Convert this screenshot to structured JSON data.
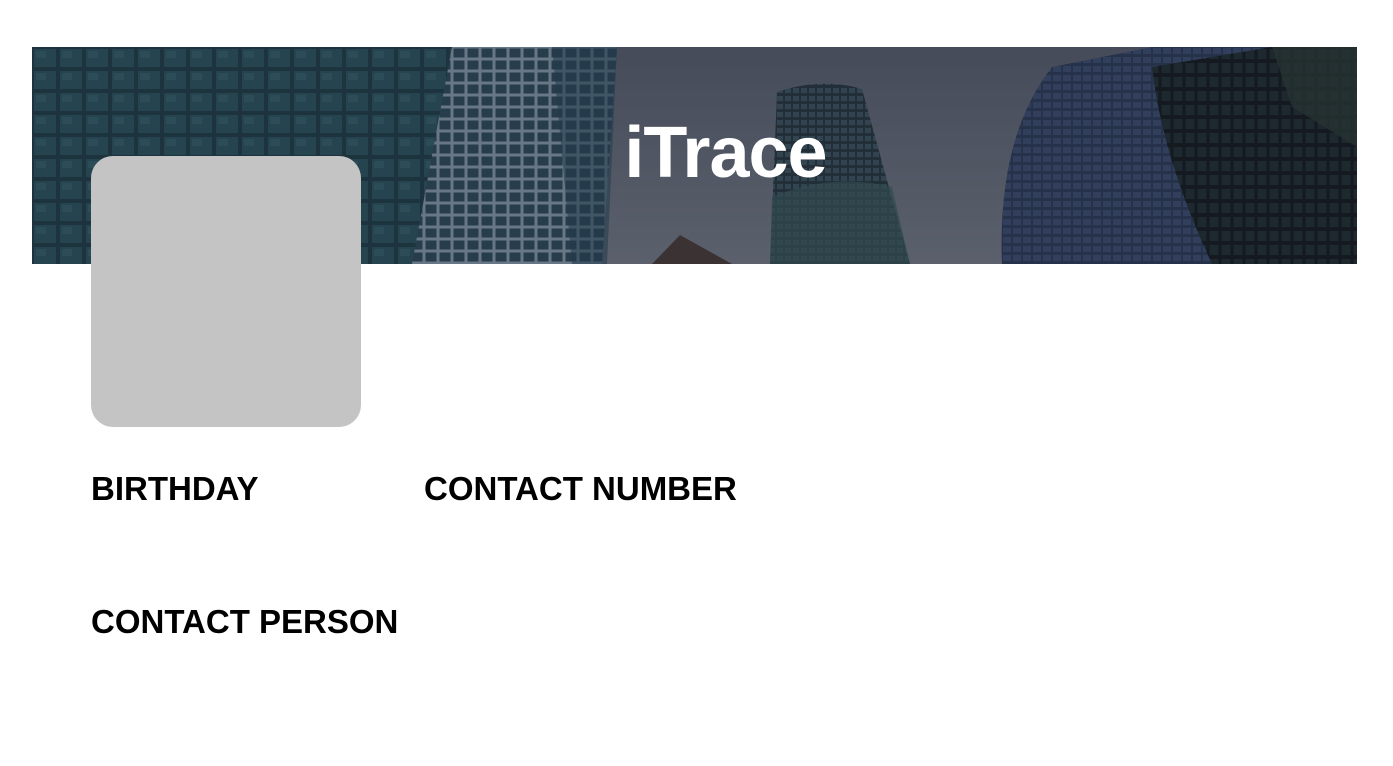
{
  "banner": {
    "title": "iTrace",
    "background_image": "city-skyscrapers-photo",
    "overlay_color": "#1f2430"
  },
  "profile": {
    "avatar": "avatar-placeholder",
    "avatar_color": "#c4c4c4"
  },
  "fields": {
    "birthday_label": "BIRTHDAY",
    "birthday_value": "",
    "contact_number_label": "CONTACT NUMBER",
    "contact_number_value": "",
    "contact_person_label": "CONTACT PERSON",
    "contact_person_value": ""
  }
}
